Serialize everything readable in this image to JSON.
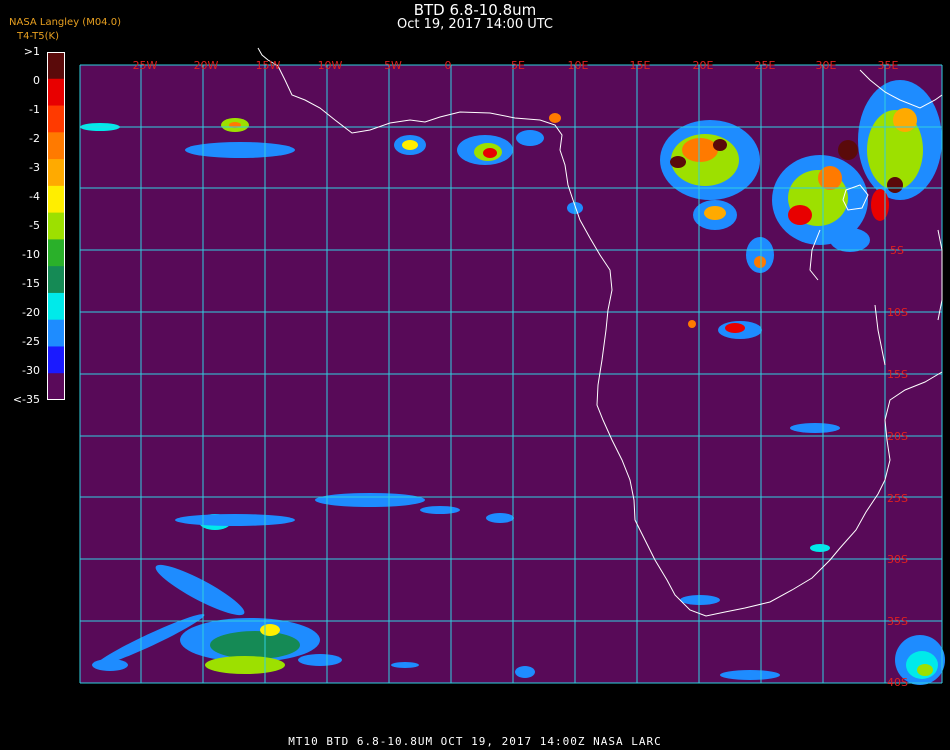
{
  "header": {
    "title": "BTD 6.8-10.8um",
    "subtitle": "Oct 19, 2017 14:00 UTC",
    "credit_line1": "NASA Langley (M04.0)",
    "credit_line2": "T4-T5(K)"
  },
  "legend": {
    "labels": [
      ">1",
      "0",
      "-1",
      "-2",
      "-3",
      "-4",
      "-5",
      "-10",
      "-15",
      "-20",
      "-25",
      "-30",
      "<-35"
    ],
    "colors": [
      "#5a0a0a",
      "#e80000",
      "#ff3a00",
      "#ff7a00",
      "#ffaa00",
      "#ffee00",
      "#9de000",
      "#2ab02a",
      "#158a55",
      "#00eaea",
      "#1e8cff",
      "#1a1aff",
      "#5a0a5a"
    ]
  },
  "map": {
    "background_color": "#580a58",
    "grid_color": "#30d0e0",
    "coast_color": "#ffffff",
    "lon_labels": [
      "25W",
      "20W",
      "15W",
      "10W",
      "5W",
      "0",
      "5E",
      "10E",
      "15E",
      "20E",
      "25E",
      "30E",
      "35E"
    ],
    "lat_labels": [
      "5S",
      "10S",
      "15S",
      "20S",
      "25S",
      "30S",
      "35S",
      "40S"
    ]
  },
  "footer": "MT10   BTD 6.8-10.8UM   OCT 19, 2017 14:00Z   NASA LARC"
}
